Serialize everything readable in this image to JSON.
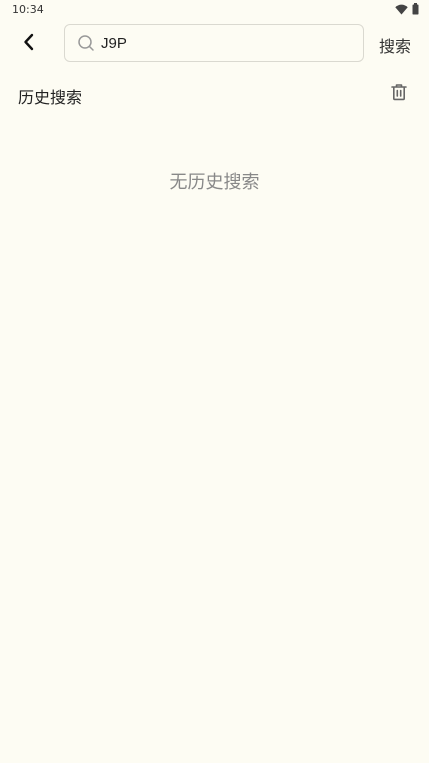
{
  "status_bar": {
    "time": "10:34",
    "icons": [
      "wifi-icon",
      "battery-icon"
    ]
  },
  "search": {
    "value": "J9P",
    "placeholder": "",
    "button_label": "搜索",
    "icon": "search-icon"
  },
  "history": {
    "title": "历史搜索",
    "clear_icon": "trash-icon",
    "empty_text": "无历史搜索"
  },
  "colors": {
    "background": "#fdfcf3",
    "border": "#dad9d0",
    "muted_text": "#888888"
  }
}
